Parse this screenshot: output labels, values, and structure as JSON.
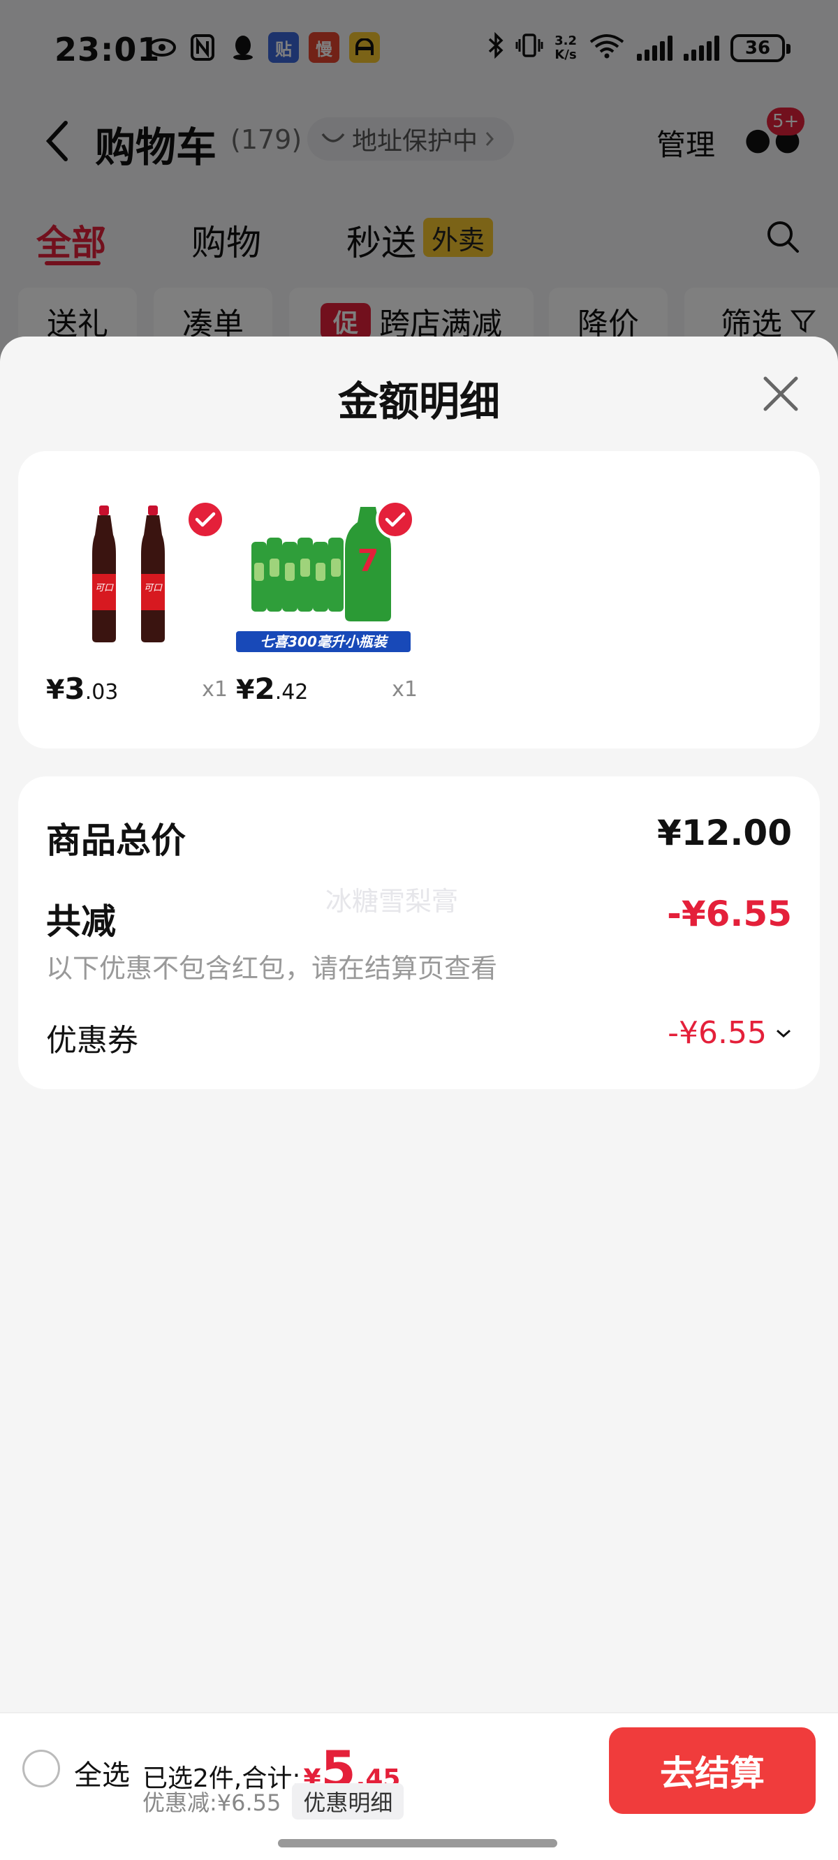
{
  "status_bar": {
    "time": "23:01",
    "speed_value": "3.2",
    "speed_unit": "K/s",
    "battery": "36",
    "app_icons": [
      {
        "name": "tie-app-icon",
        "label": "贴",
        "color": "#3a66d8"
      },
      {
        "name": "man-app-icon",
        "label": "慢",
        "color": "#e4442f"
      },
      {
        "name": "meituan-app-icon",
        "label": "",
        "color": "#f7c62e"
      }
    ]
  },
  "header": {
    "title": "购物车",
    "count": "(179)",
    "address_protect": "地址保护中",
    "manage": "管理",
    "badge": "5+"
  },
  "tabs": {
    "all": "全部",
    "shopping": "购物",
    "instant": "秒送",
    "instant_tag": "外卖"
  },
  "filters": {
    "gift": "送礼",
    "bundle": "凑单",
    "promo_tag": "促",
    "cross_store": "跨店满减",
    "price_drop": "降价",
    "filter": "筛选"
  },
  "sheet": {
    "title": "金额明细",
    "products": [
      {
        "name": "可口可乐",
        "price_symbol": "¥",
        "price_int": "3",
        "price_dec": ".03",
        "qty": "x1"
      },
      {
        "name": "七喜",
        "banner": "七喜300毫升小瓶装",
        "price_symbol": "¥",
        "price_int": "2",
        "price_dec": ".42",
        "qty": "x1"
      }
    ],
    "total_label": "商品总价",
    "total_value": "¥12.00",
    "reduction_label": "共减",
    "reduction_value": "-¥6.55",
    "reduction_note": "以下优惠不包含红包，请在结算页查看",
    "watermark": "冰糖雪梨膏",
    "coupon_label": "优惠券",
    "coupon_value": "-¥6.55"
  },
  "bottom_bar": {
    "select_all": "全选",
    "selected_text": "已选2件,合计:",
    "total_symbol": "¥",
    "total_int": "5",
    "total_dec": ".45",
    "discount_text": "优惠减:¥6.55",
    "detail_button": "优惠明细",
    "checkout": "去结算"
  },
  "colors": {
    "accent": "#e4203a",
    "checkout": "#f03c3c",
    "background": "#f5f5f5"
  }
}
